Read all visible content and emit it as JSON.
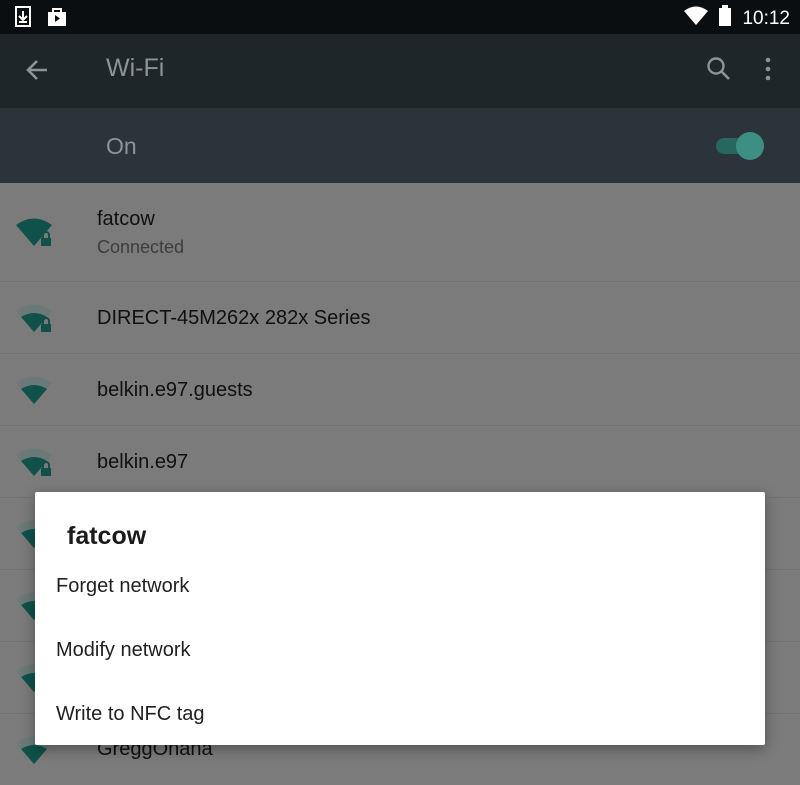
{
  "status_bar": {
    "left_icons": [
      "download-icon",
      "shopping-bag-icon"
    ],
    "right_icons": [
      "wifi-signal-icon",
      "battery-icon"
    ],
    "time": "10:12"
  },
  "app_bar": {
    "title": "Wi-Fi",
    "icons": [
      "back-arrow-icon",
      "search-icon",
      "more-vert-icon"
    ]
  },
  "wifi_switch": {
    "label": "On",
    "state": "on",
    "accent_color": "#3d8f84"
  },
  "networks": [
    {
      "name": "fatcow",
      "status": "Connected",
      "secured": true
    },
    {
      "name": "DIRECT-45M262x 282x Series",
      "secured": true
    },
    {
      "name": "belkin.e97.guests",
      "secured": false
    },
    {
      "name": "belkin.e97",
      "secured": true
    },
    {
      "name": "GreggOhana",
      "secured": true
    }
  ],
  "dialog": {
    "title": "fatcow",
    "items": [
      "Forget network",
      "Modify network",
      "Write to NFC tag"
    ]
  }
}
